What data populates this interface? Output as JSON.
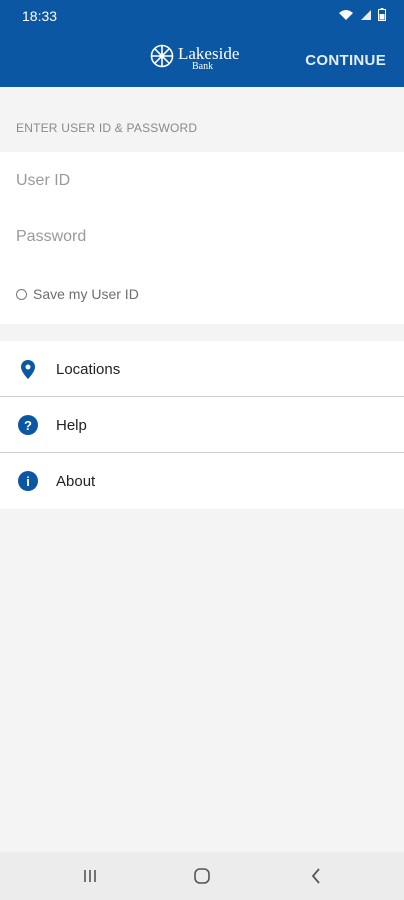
{
  "status_bar": {
    "time": "18:33"
  },
  "app_bar": {
    "logo_name": "Lakeside",
    "logo_sub": "Bank",
    "continue_label": "CONTINUE"
  },
  "login": {
    "section_title": "ENTER USER ID & PASSWORD",
    "user_id_placeholder": "User ID",
    "password_placeholder": "Password",
    "save_label": "Save my User ID"
  },
  "menu": {
    "items": [
      {
        "label": "Locations",
        "icon": "location-pin-icon"
      },
      {
        "label": "Help",
        "icon": "help-icon"
      },
      {
        "label": "About",
        "icon": "info-icon"
      }
    ]
  },
  "colors": {
    "brand": "#0b57a4"
  }
}
